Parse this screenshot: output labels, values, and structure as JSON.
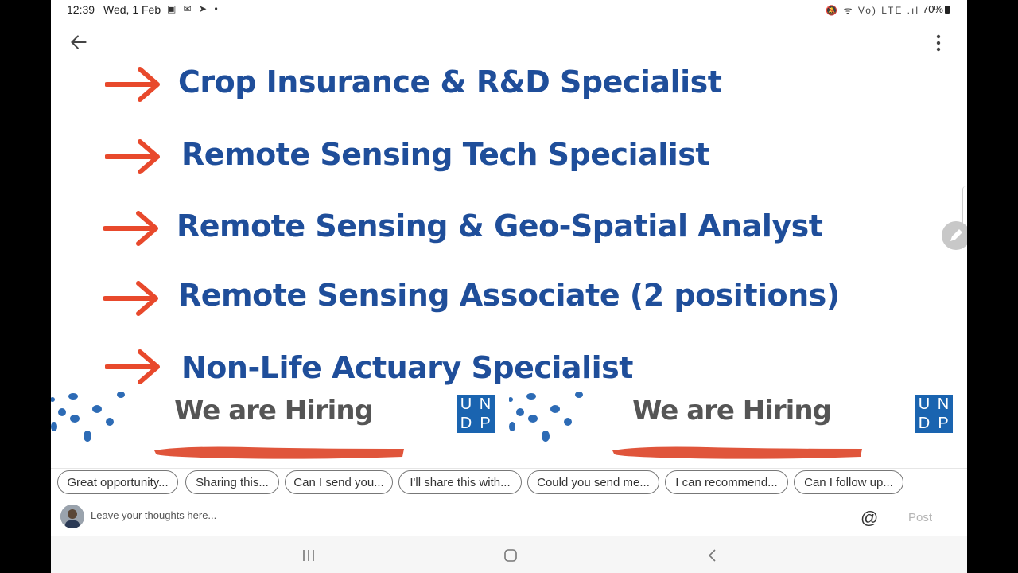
{
  "status": {
    "time": "12:39",
    "date": "Wed, 1 Feb",
    "left_icons": "▣ ✉ ➤ •",
    "right_icons": "🔕 ᯤ Vo) LTE .ıl",
    "battery": "70%"
  },
  "post": {
    "jobs": [
      "Crop Insurance & R&D Specialist",
      "Remote Sensing Tech Specialist",
      "Remote Sensing & Geo-Spatial Analyst",
      "Remote Sensing Associate (2 positions)",
      "Non-Life Actuary Specialist"
    ],
    "hiring_text": "We are Hiring",
    "logo_letters": [
      "U",
      "N",
      "D",
      "P"
    ]
  },
  "suggestions": [
    "Great opportunity...",
    "Sharing this...",
    "Can I send you...",
    "I'll share this with...",
    "Could you send me...",
    "I can recommend...",
    "Can I follow up..."
  ],
  "comment": {
    "placeholder": "Leave your thoughts here...",
    "at_symbol": "@",
    "post_label": "Post"
  },
  "colors": {
    "job_text": "#1f4e9a",
    "arrow": "#e8492c",
    "undp_blue": "#1a64b0"
  }
}
